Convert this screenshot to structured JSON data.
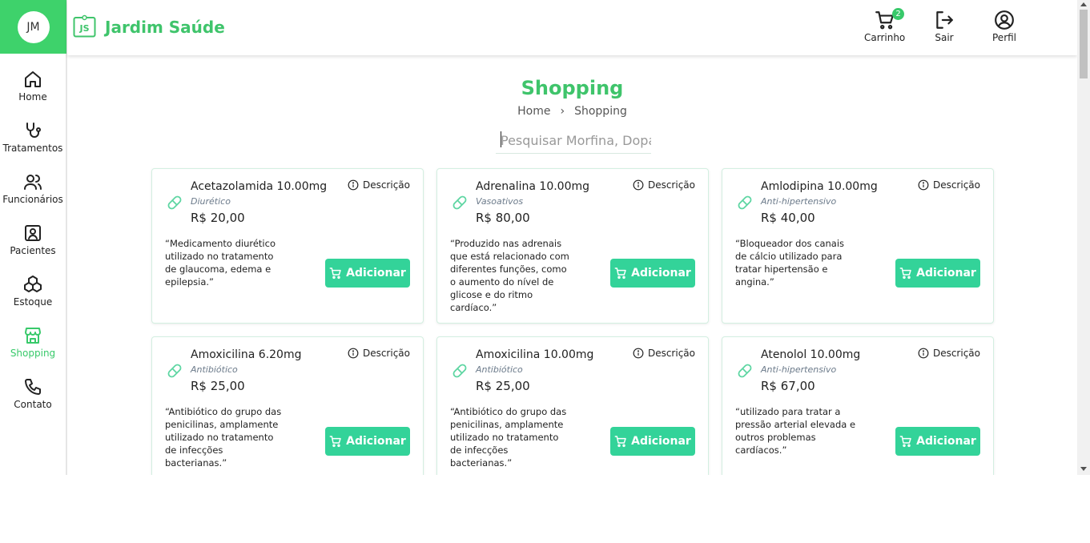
{
  "sidebar": {
    "avatar_initials": "JM",
    "items": [
      {
        "label": "Home",
        "icon": "home-icon",
        "active": false
      },
      {
        "label": "Tratamentos",
        "icon": "stethoscope-icon",
        "active": false
      },
      {
        "label": "Funcionários",
        "icon": "users-icon",
        "active": false
      },
      {
        "label": "Pacientes",
        "icon": "patient-icon",
        "active": false
      },
      {
        "label": "Estoque",
        "icon": "boxes-icon",
        "active": false
      },
      {
        "label": "Shopping",
        "icon": "store-icon",
        "active": true
      },
      {
        "label": "Contato",
        "icon": "phone-icon",
        "active": false
      }
    ]
  },
  "header": {
    "logo_text": "JS",
    "brand": "Jardim Saúde",
    "cart_label": "Carrinho",
    "cart_count": "2",
    "logout_label": "Sair",
    "profile_label": "Perfil"
  },
  "main": {
    "title": "Shopping",
    "breadcrumb": {
      "home": "Home",
      "separator": "›",
      "current": "Shopping"
    },
    "search_placeholder": "Pesquisar Morfina, Dopam",
    "description_label": "Descrição",
    "add_label": "Adicionar",
    "products": [
      {
        "name": "Acetazolamida 10.00mg",
        "category": "Diurético",
        "price": "R$ 20,00",
        "description": "“Medicamento diurético utilizado no tratamento de glaucoma, edema e epilepsia.”"
      },
      {
        "name": "Adrenalina 10.00mg",
        "category": "Vasoativos",
        "price": "R$ 80,00",
        "description": "“Produzido nas adrenais que está relacionado com diferentes funções, como o aumento do nível de glicose e do ritmo cardíaco.”"
      },
      {
        "name": "Amlodipina 10.00mg",
        "category": "Anti-hipertensivo",
        "price": "R$ 40,00",
        "description": "“Bloqueador dos canais de cálcio utilizado para tratar hipertensão e angina.”"
      },
      {
        "name": "Amoxicilina 6.20mg",
        "category": "Antibiótico",
        "price": "R$ 25,00",
        "description": "“Antibiótico do grupo das penicilinas, amplamente utilizado no tratamento de infecções bacterianas.”"
      },
      {
        "name": "Amoxicilina 10.00mg",
        "category": "Antibiótico",
        "price": "R$ 25,00",
        "description": "“Antibiótico do grupo das penicilinas, amplamente utilizado no tratamento de infecções bacterianas.”"
      },
      {
        "name": "Atenolol 10.00mg",
        "category": "Anti-hipertensivo",
        "price": "R$ 67,00",
        "description": "“utilizado para tratar a pressão arterial elevada e outros problemas cardíacos.”"
      }
    ]
  },
  "colors": {
    "accent": "#3fc46b",
    "button": "#33d399",
    "card_border": "#d3efe1"
  }
}
